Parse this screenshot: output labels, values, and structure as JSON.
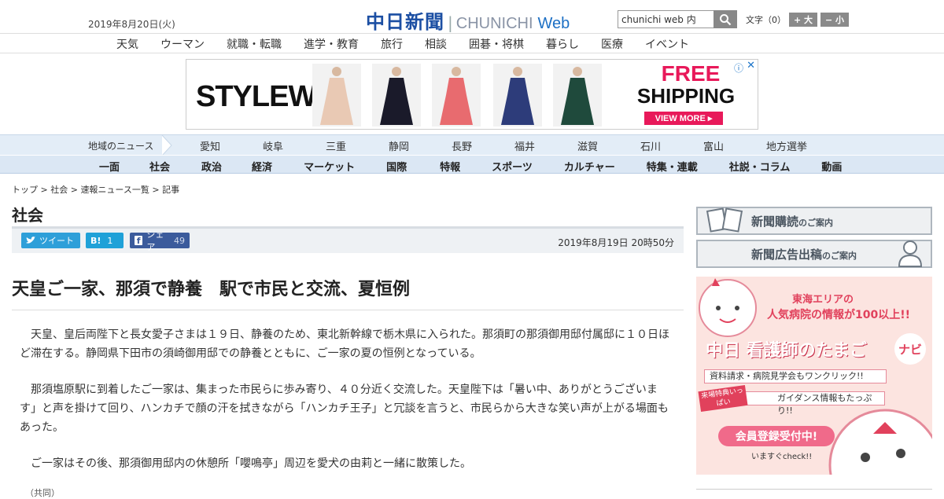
{
  "header": {
    "date": "2019年8月20日(火)",
    "logo_jp": "中日新聞",
    "logo_en": "CHUNICHI",
    "logo_web": "Web",
    "search_value": "chunichi web 内",
    "font_size_label": "文字（0）",
    "font_bigger": "+ 大",
    "font_smaller": "− 小"
  },
  "top_nav": [
    "天気",
    "ウーマン",
    "就職・転職",
    "進学・教育",
    "旅行",
    "相談",
    "囲碁・将棋",
    "暮らし",
    "医療",
    "イベント"
  ],
  "ad": {
    "brand": "STYLEWE",
    "headline1": "FREE",
    "headline2": "SHIPPING",
    "cta": "VIEW MORE ▸",
    "info": "ⓘ",
    "close": "✕",
    "dress_colors": [
      "#e9c9b4",
      "#1a1a2a",
      "#e86b6f",
      "#2d3c7a",
      "#1f4a3c"
    ]
  },
  "region": {
    "label": "地域のニュース",
    "items": [
      "愛知",
      "岐阜",
      "三重",
      "静岡",
      "長野",
      "福井",
      "滋賀",
      "石川",
      "富山",
      "地方選挙"
    ]
  },
  "main_nav": [
    "一面",
    "社会",
    "政治",
    "経済",
    "マーケット",
    "国際",
    "特報",
    "スポーツ",
    "カルチャー",
    "特集・連載",
    "社説・コラム",
    "動画"
  ],
  "breadcrumb": {
    "top": "トップ",
    "sep": " > ",
    "section": "社会",
    "list": "速報ニュース一覧",
    "current": "記事"
  },
  "section_title": "社会",
  "share": {
    "tweet": "ツイート",
    "hatena_label": "B!",
    "hatena_count": "1",
    "fb_label": "シェア",
    "fb_count": "49",
    "pub_date": "2019年8月19日 20時50分"
  },
  "article": {
    "headline": "天皇ご一家、那須で静養　駅で市民と交流、夏恒例",
    "paragraphs": [
      "天皇、皇后両陛下と長女愛子さまは１９日、静養のため、東北新幹線で栃木県に入られた。那須町の那須御用邸付属邸に１０日ほど滞在する。静岡県下田市の須崎御用邸での静養とともに、ご一家の夏の恒例となっている。",
      "那須塩原駅に到着したご一家は、集まった市民らに歩み寄り、４０分近く交流した。天皇陛下は「暑い中、ありがとうございます」と声を掛けて回り、ハンカチで顔の汗を拭きながら「ハンカチ王子」と冗談を言うと、市民らから大きな笑い声が上がる場面もあった。",
      "ご一家はその後、那須御用邸内の休憩所「嚶鳴亭」周辺を愛犬の由莉と一緒に散策した。"
    ],
    "credit": "（共同）"
  },
  "sidebar": {
    "subscribe": "新聞購読",
    "subscribe_suffix": "のご案内",
    "advertise": "新聞広告出稿",
    "advertise_suffix": "のご案内",
    "nurse_ad": {
      "line1": "東海エリアの",
      "line2": "人気病院の情報が100以上!!",
      "title": "中日 看護師のたまご",
      "navi": "ナビ",
      "strip1": "資料請求・病院見学会もワンクリック!!",
      "badge": "来場特典いっぱい",
      "strip2": "ガイダンス情報もたっぷり!!",
      "cta": "会員登録受付中!",
      "sub": "いますぐcheck!!"
    }
  }
}
